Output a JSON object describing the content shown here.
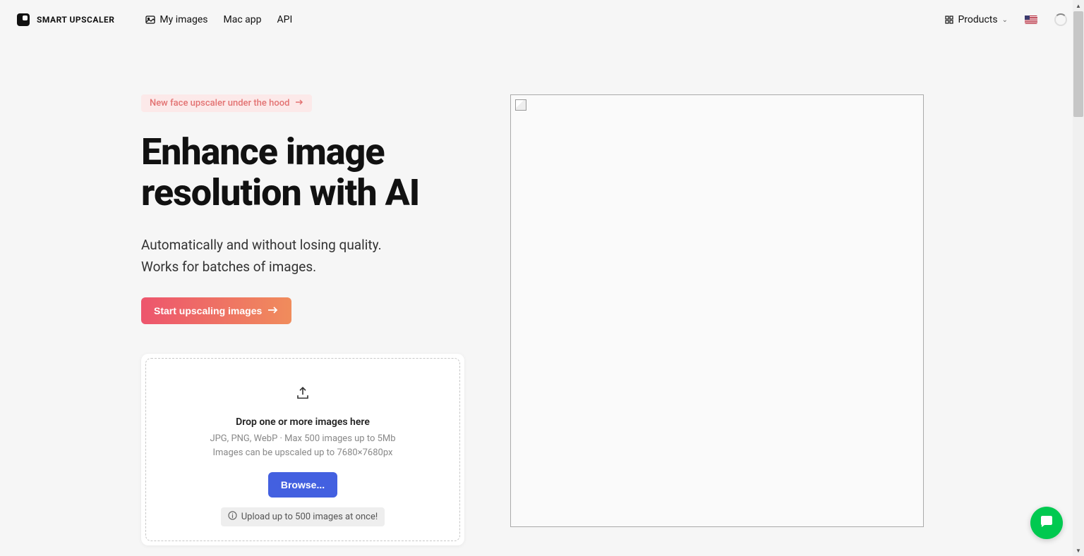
{
  "header": {
    "logo_text": "SMART UPSCALER",
    "nav": [
      {
        "label": "My images"
      },
      {
        "label": "Mac app"
      },
      {
        "label": "API"
      }
    ],
    "products_label": "Products"
  },
  "hero": {
    "badge_text": "New face upscaler under the hood",
    "title": "Enhance image resolution with AI",
    "subtitle_line1": "Automatically and without losing quality.",
    "subtitle_line2": "Works for batches of images.",
    "cta_label": "Start upscaling images"
  },
  "upload": {
    "drop_title": "Drop one or more images here",
    "drop_subtitle_line1": "JPG, PNG, WebP · Max 500 images up to 5Mb",
    "drop_subtitle_line2": "Images can be upscaled up to 7680×7680px",
    "browse_label": "Browse...",
    "hint": "Upload up to 500 images at once!"
  }
}
